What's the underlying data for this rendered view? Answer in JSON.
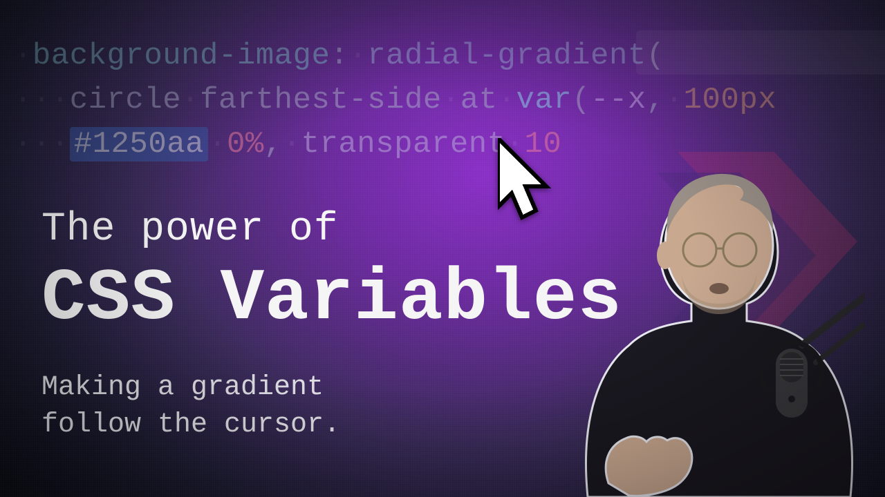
{
  "code": {
    "line1": {
      "property": "background-image",
      "func": "radial-gradient"
    },
    "line2": {
      "shape": "circle",
      "extent": "farthest-side",
      "at": "at",
      "varfn": "var",
      "varname": "--x",
      "fallback": "100px"
    },
    "line3": {
      "hex": "#1250aa",
      "pct0": "0%",
      "transparent": "transparent",
      "pct100": "10"
    }
  },
  "titles": {
    "line1": "The power of",
    "line2": "CSS Variables",
    "sub1": "Making a gradient",
    "sub2": "follow the cursor."
  },
  "icons": {
    "cursor": "cursor-arrow-icon",
    "logo": "chevron-logo-icon",
    "mic": "microphone-icon",
    "presenter": "presenter-silhouette"
  },
  "colors": {
    "bg_purple": "#8a2fc7",
    "bg_dark": "#1a1a2e",
    "accent_pink": "#d6336c",
    "text": "#f5f5f5"
  }
}
